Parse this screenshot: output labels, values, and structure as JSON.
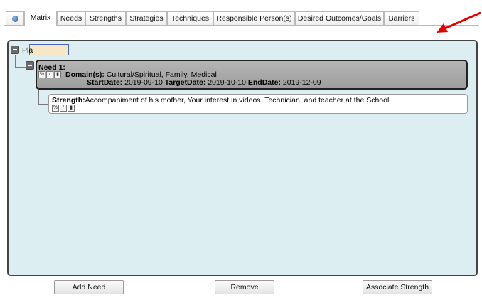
{
  "tabs": [
    {
      "label": ""
    },
    {
      "label": "Matrix"
    },
    {
      "label": "Needs"
    },
    {
      "label": "Strengths"
    },
    {
      "label": "Strategies"
    },
    {
      "label": "Techniques"
    },
    {
      "label": "Responsible Person(s)"
    },
    {
      "label": "Desired Outcomes/Goals"
    },
    {
      "label": "Barriers"
    }
  ],
  "tree": {
    "plan_label": "Pla",
    "need": {
      "title": "Need 1:",
      "domain_label": "Domain(s):",
      "domain_value": "Cultural/Spiritual, Family, Medical",
      "start_label": "StartDate:",
      "start_value": "2019-09-10",
      "target_label": "TargetDate:",
      "target_value": "2019-10-10",
      "end_label": "EndDate:",
      "end_value": "2019-12-09"
    },
    "strength": {
      "label": "Strength:",
      "value": "Accompaniment of his mother, Your interest in videos. Technician, and teacher at the School."
    }
  },
  "buttons": {
    "add_need": "Add Need",
    "remove": "Remove",
    "associate_strength": "Associate Strength"
  },
  "colors": {
    "panel_bg": "#ddeef3",
    "need_bg": "#a8a8a8",
    "arrow": "#e00000",
    "highlight": "#f6e8c6"
  }
}
